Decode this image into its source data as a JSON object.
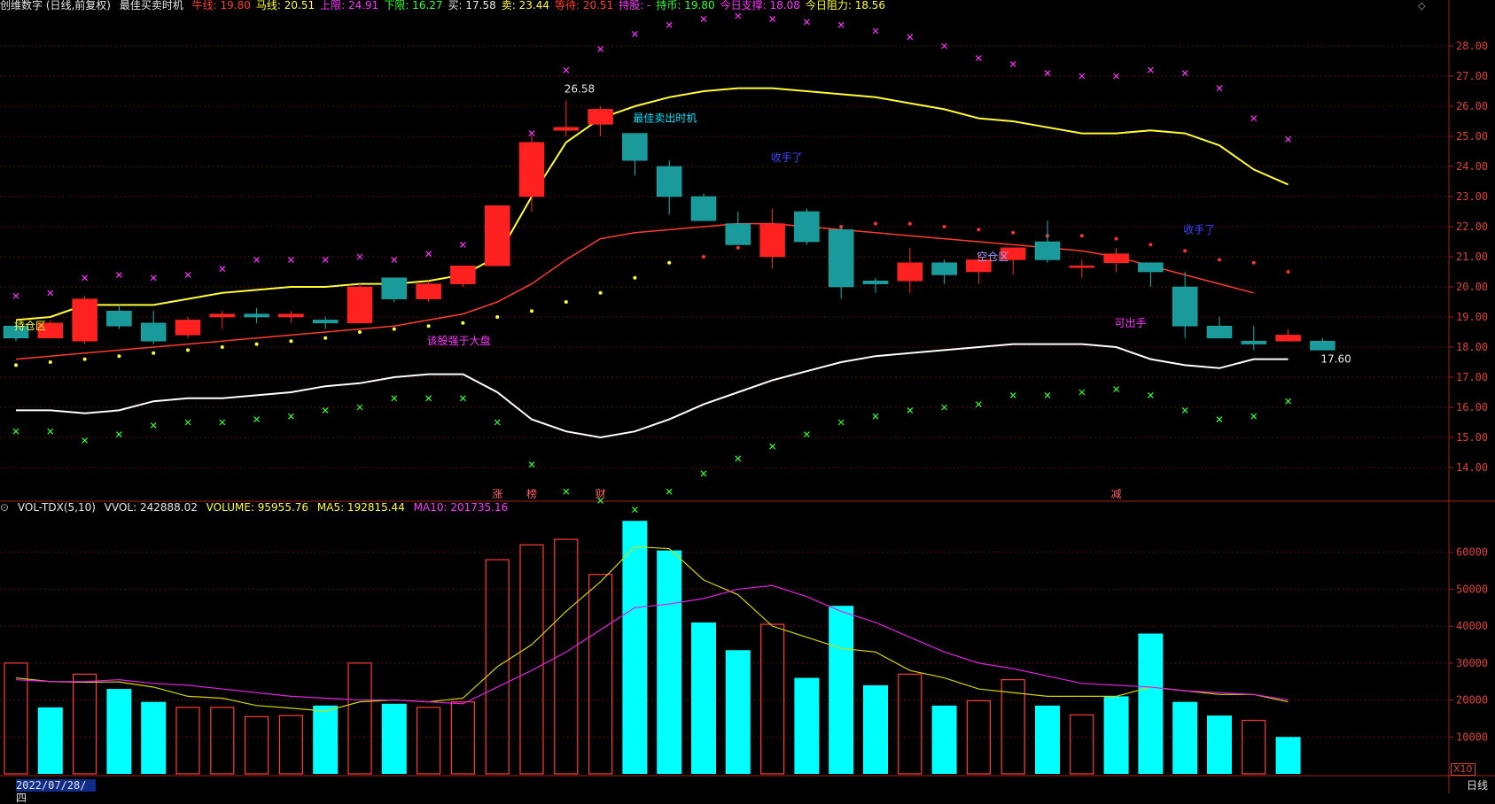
{
  "header": {
    "title": "创维数字 (日线,前复权)",
    "indicator": "最佳买卖时机",
    "items": [
      {
        "label": "牛线:",
        "value": "19.80",
        "color": "#ff3b30"
      },
      {
        "label": "马线:",
        "value": "20.51",
        "color": "#ffff33"
      },
      {
        "label": "上限:",
        "value": "24.91",
        "color": "#ff33ff"
      },
      {
        "label": "下限:",
        "value": "16.27",
        "color": "#33ff33"
      },
      {
        "label": "买:",
        "value": "17.58",
        "color": "#e8e8e8"
      },
      {
        "label": "卖:",
        "value": "23.44",
        "color": "#ffff33"
      },
      {
        "label": "等待:",
        "value": "20.51",
        "color": "#ff3b30"
      },
      {
        "label": "持股:",
        "value": "-",
        "color": "#ff33ff"
      },
      {
        "label": "持币:",
        "value": "19.80",
        "color": "#33ff33"
      },
      {
        "label": "今日支撑:",
        "value": "18.08",
        "color": "#ff33ff"
      },
      {
        "label": "今日阻力:",
        "value": "18.56",
        "color": "#ffff33"
      }
    ]
  },
  "vol_header": {
    "name": "VOL-TDX(5,10)",
    "vvol": "VVOL: 242888.02",
    "volume": "VOLUME: 95955.76",
    "ma5": "MA5: 192815.44",
    "ma10": "MA10: 201735.16"
  },
  "colors": {
    "up": "#ff2a2a",
    "down": "#1fb5b5",
    "vol_up": "#ff3b3b",
    "vol_down": "#00ffff",
    "bull": "#ff3b30",
    "horse": "#ffff33",
    "upper": "#ff33ff",
    "lower": "#33ff33",
    "buy": "#ffffff"
  },
  "chart_data": [
    {
      "type": "candlestick",
      "ylim": [
        13.0,
        29.0
      ],
      "y_ticks": [
        14.0,
        15.0,
        16.0,
        17.0,
        18.0,
        19.0,
        20.0,
        21.0,
        22.0,
        23.0,
        24.0,
        25.0,
        26.0,
        27.0,
        28.0
      ],
      "y_tick_labels": [
        "14.00",
        "15.00",
        "16.00",
        "17.00",
        "18.00",
        "19.00",
        "20.00",
        "21.00",
        "22.00",
        "23.00",
        "24.00",
        "25.00",
        "26.00",
        "27.00",
        "28.00"
      ],
      "ohlc": [
        [
          18.7,
          18.8,
          18.2,
          18.3
        ],
        [
          18.3,
          18.9,
          18.3,
          18.8
        ],
        [
          18.2,
          19.7,
          18.1,
          19.6
        ],
        [
          19.2,
          19.4,
          18.6,
          18.7
        ],
        [
          18.8,
          19.2,
          18.1,
          18.2
        ],
        [
          18.4,
          19.0,
          18.3,
          18.9
        ],
        [
          19.0,
          19.2,
          18.6,
          19.1
        ],
        [
          19.1,
          19.3,
          18.8,
          19.0
        ],
        [
          19.0,
          19.2,
          18.8,
          19.1
        ],
        [
          18.9,
          19.0,
          18.6,
          18.8
        ],
        [
          18.8,
          20.1,
          18.8,
          20.0
        ],
        [
          20.3,
          20.3,
          19.5,
          19.6
        ],
        [
          19.6,
          20.2,
          19.5,
          20.1
        ],
        [
          20.1,
          20.7,
          20.0,
          20.7
        ],
        [
          20.7,
          22.7,
          20.7,
          22.7
        ],
        [
          23.0,
          25.0,
          22.5,
          24.8
        ],
        [
          25.2,
          26.2,
          25.0,
          25.3
        ],
        [
          25.4,
          26.0,
          25.0,
          25.9
        ],
        [
          25.1,
          25.1,
          23.7,
          24.2
        ],
        [
          24.0,
          24.2,
          22.4,
          23.0
        ],
        [
          23.0,
          23.1,
          22.2,
          22.2
        ],
        [
          22.1,
          22.5,
          21.5,
          21.4
        ],
        [
          21.0,
          22.6,
          20.6,
          22.1
        ],
        [
          22.5,
          22.6,
          21.4,
          21.5
        ],
        [
          21.9,
          22.0,
          19.6,
          20.0
        ],
        [
          20.2,
          20.3,
          19.8,
          20.1
        ],
        [
          20.2,
          21.3,
          19.8,
          20.8
        ],
        [
          20.8,
          20.9,
          20.1,
          20.4
        ],
        [
          20.5,
          21.1,
          20.1,
          20.9
        ],
        [
          20.9,
          21.3,
          20.4,
          21.3
        ],
        [
          21.5,
          22.2,
          20.8,
          20.9
        ],
        [
          20.7,
          20.9,
          20.3,
          20.7
        ],
        [
          20.8,
          21.3,
          20.5,
          21.1
        ],
        [
          20.8,
          20.8,
          20.0,
          20.5
        ],
        [
          20.0,
          20.5,
          18.3,
          18.7
        ],
        [
          18.7,
          19.0,
          18.4,
          18.3
        ],
        [
          18.2,
          18.7,
          17.9,
          18.1
        ],
        [
          18.2,
          18.6,
          18.2,
          18.4
        ],
        [
          18.2,
          18.3,
          17.9,
          17.9
        ]
      ],
      "ma_yellow": [
        18.9,
        19.0,
        19.4,
        19.4,
        19.4,
        19.6,
        19.8,
        19.9,
        20.0,
        20.0,
        20.1,
        20.1,
        20.2,
        20.4,
        21.0,
        23.0,
        24.8,
        25.6,
        26.0,
        26.3,
        26.5,
        26.6,
        26.6,
        26.5,
        26.4,
        26.3,
        26.1,
        25.9,
        25.6,
        25.5,
        25.3,
        25.1,
        25.1,
        25.2,
        25.1,
        24.7,
        23.9,
        23.4
      ],
      "ma_red": [
        17.6,
        17.7,
        17.8,
        17.9,
        18.0,
        18.1,
        18.2,
        18.3,
        18.4,
        18.5,
        18.6,
        18.7,
        18.9,
        19.1,
        19.5,
        20.1,
        20.9,
        21.6,
        21.8,
        21.9,
        22.0,
        22.1,
        22.1,
        22.0,
        21.9,
        21.8,
        21.7,
        21.6,
        21.5,
        21.4,
        21.3,
        21.2,
        21.0,
        20.7,
        20.4,
        20.1,
        19.8
      ],
      "ma_white": [
        15.9,
        15.9,
        15.8,
        15.9,
        16.2,
        16.3,
        16.3,
        16.4,
        16.5,
        16.7,
        16.8,
        17.0,
        17.1,
        17.1,
        16.5,
        15.6,
        15.2,
        15.0,
        15.2,
        15.6,
        16.1,
        16.5,
        16.9,
        17.2,
        17.5,
        17.7,
        17.8,
        17.9,
        18.0,
        18.1,
        18.1,
        18.1,
        18.0,
        17.6,
        17.4,
        17.3,
        17.6,
        17.6
      ],
      "upper_marks": [
        19.7,
        19.8,
        20.3,
        20.4,
        20.3,
        20.4,
        20.6,
        20.9,
        20.9,
        20.9,
        21.0,
        20.9,
        21.1,
        21.4,
        22.6,
        25.1,
        27.2,
        27.9,
        28.4,
        28.7,
        28.9,
        29.0,
        28.9,
        28.8,
        28.7,
        28.5,
        28.3,
        28.0,
        27.6,
        27.4,
        27.1,
        27.0,
        27.0,
        27.2,
        27.1,
        26.6,
        25.6,
        24.9
      ],
      "lower_marks": [
        15.2,
        15.2,
        14.9,
        15.1,
        15.4,
        15.5,
        15.5,
        15.6,
        15.7,
        15.9,
        16.0,
        16.3,
        16.3,
        16.3,
        15.5,
        14.1,
        13.2,
        12.9,
        12.6,
        13.2,
        13.8,
        14.3,
        14.7,
        15.1,
        15.5,
        15.7,
        15.9,
        16.0,
        16.1,
        16.4,
        16.4,
        16.5,
        16.6,
        16.4,
        15.9,
        15.6,
        15.7,
        16.2
      ],
      "mid_dots": [
        17.4,
        17.5,
        17.6,
        17.7,
        17.8,
        17.9,
        18.0,
        18.1,
        18.2,
        18.3,
        18.5,
        18.6,
        18.7,
        18.8,
        19.0,
        19.2,
        19.5,
        19.8,
        20.3,
        20.8,
        21.0,
        21.3,
        21.6,
        21.8,
        22.0,
        22.1,
        22.1,
        22.0,
        21.9,
        21.8,
        21.7,
        21.7,
        21.6,
        21.4,
        21.2,
        20.9,
        20.8,
        20.5
      ],
      "annotations": [
        {
          "text": "26.58",
          "i": 16,
          "y": 26.58,
          "color": "#e8e8e8"
        },
        {
          "text": "最佳卖出时机",
          "i": 18,
          "y": 25.6,
          "color": "#00e5ff"
        },
        {
          "text": "收手了",
          "i": 22,
          "y": 24.3,
          "color": "#4040ff"
        },
        {
          "text": "收手了",
          "i": 34,
          "y": 21.9,
          "color": "#4040ff"
        },
        {
          "text": "空仓区",
          "i": 28,
          "y": 21.0,
          "color": "#a0a0ff"
        },
        {
          "text": "可出手",
          "i": 32,
          "y": 18.8,
          "color": "#ff33ff"
        },
        {
          "text": "持仓区",
          "i": 0,
          "y": 18.7,
          "color": "#ffff33"
        },
        {
          "text": "该股强于大盘",
          "i": 12,
          "y": 18.2,
          "color": "#ff33ff"
        },
        {
          "text": "17.60",
          "i": 38,
          "y": 17.6,
          "color": "#e8e8e8"
        }
      ],
      "event_tags": [
        {
          "text": "涨",
          "i": 14
        },
        {
          "text": "榜",
          "i": 15
        },
        {
          "text": "财",
          "i": 17
        },
        {
          "text": "减",
          "i": 32
        }
      ]
    },
    {
      "type": "bar",
      "title": "VOL-TDX(5,10)",
      "ylim": [
        0,
        70000
      ],
      "y_ticks": [
        10000,
        20000,
        30000,
        40000,
        50000,
        60000
      ],
      "y_tick_labels": [
        "10000",
        "20000",
        "30000",
        "40000",
        "50000",
        "60000"
      ],
      "volume": [
        30000,
        18000,
        27000,
        23000,
        19500,
        18000,
        18000,
        15500,
        15800,
        18500,
        30000,
        19000,
        18000,
        19500,
        58000,
        62000,
        63500,
        54000,
        68500,
        60500,
        41000,
        33500,
        40500,
        26000,
        45500,
        24000,
        27000,
        18500,
        19800,
        25500,
        18500,
        16000,
        21000,
        38000,
        19500,
        15800,
        14500,
        10000
      ],
      "up": [
        1,
        0,
        1,
        0,
        0,
        1,
        1,
        1,
        1,
        0,
        1,
        0,
        1,
        1,
        1,
        1,
        1,
        1,
        0,
        0,
        0,
        0,
        1,
        0,
        0,
        0,
        1,
        0,
        1,
        1,
        0,
        1,
        0,
        0,
        0,
        0,
        1,
        0
      ],
      "ma5": [
        26000,
        25000,
        24800,
        24900,
        23500,
        21000,
        20500,
        18500,
        17800,
        17000,
        19500,
        20000,
        19500,
        20500,
        29000,
        35000,
        44000,
        52000,
        61500,
        61000,
        52500,
        48500,
        40000,
        37000,
        34000,
        33000,
        28000,
        26000,
        23000,
        22000,
        21000,
        21000,
        21000,
        23500,
        22500,
        21500,
        21500,
        19500
      ],
      "ma10": [
        25500,
        25000,
        25000,
        25500,
        24500,
        24000,
        23000,
        22000,
        21000,
        20500,
        20000,
        20000,
        19500,
        19000,
        23500,
        28000,
        33000,
        39000,
        45000,
        46000,
        47500,
        50000,
        51000,
        48000,
        44000,
        41000,
        37000,
        33000,
        30000,
        28500,
        26500,
        24500,
        24000,
        23500,
        22500,
        22000,
        21500,
        20000
      ]
    }
  ],
  "footer": {
    "date": "2022/07/28/四",
    "period": "日线",
    "scale": "X10"
  }
}
